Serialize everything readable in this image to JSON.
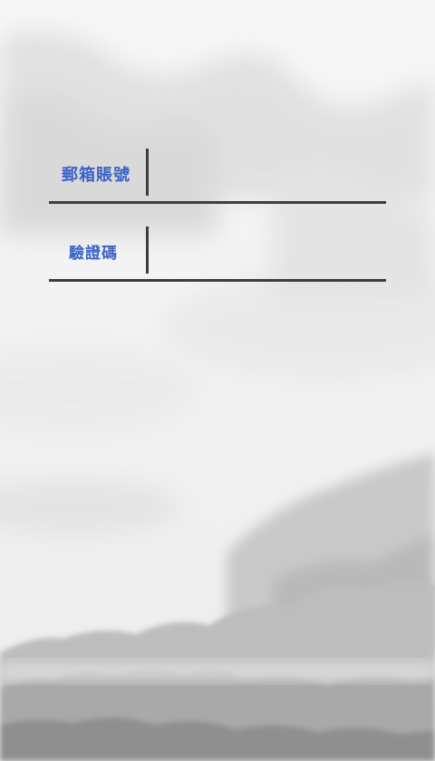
{
  "form": {
    "email": {
      "label": "郵箱賬號",
      "value": "",
      "placeholder": ""
    },
    "code": {
      "label": "驗證碼",
      "value": "",
      "placeholder": ""
    }
  },
  "colors": {
    "label": "#3a63c8",
    "separator": "#3b3b3b",
    "underline": "#3e3e3e",
    "background": "#f1f1f1"
  }
}
